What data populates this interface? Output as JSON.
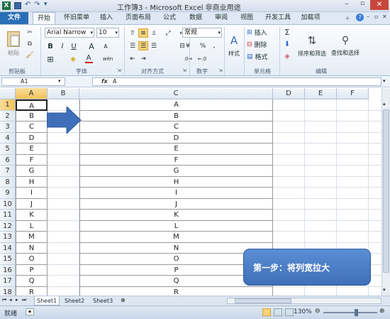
{
  "window": {
    "title": "工作簿3 - Microsoft Excel 非商业用途"
  },
  "tabs": [
    "文件",
    "开始",
    "怀旧菜单",
    "插入",
    "页面布局",
    "公式",
    "数据",
    "审阅",
    "视图",
    "开发工具",
    "加载项"
  ],
  "ribbon": {
    "paste": "粘贴",
    "clipboard_label": "剪贴板",
    "font_name": "Arial Narrow",
    "font_size": "10",
    "bold": "B",
    "italic": "I",
    "underline": "U",
    "font_grow": "A",
    "font_shrink": "A",
    "font_color_glyph": "A",
    "wen": "wén",
    "font_label": "字体",
    "align_label": "对齐方式",
    "number_format": "常规",
    "percent": "%",
    "comma": ",",
    "number_label": "数字",
    "style": "样式",
    "insert": "插入",
    "delete": "删除",
    "format": "格式",
    "cells_label": "单元格",
    "sort_filter": "排序和筛选",
    "find_select": "查找和选择",
    "edit_label": "编辑"
  },
  "formula_bar": {
    "name_box": "A1",
    "fx": "fx",
    "content": "A"
  },
  "columns": [
    "A",
    "B",
    "C",
    "D",
    "E",
    "F"
  ],
  "rows": [
    "1",
    "2",
    "3",
    "4",
    "5",
    "6",
    "7",
    "8",
    "9",
    "10",
    "11",
    "12",
    "13",
    "14",
    "15",
    "16",
    "17",
    "18"
  ],
  "col_a_values": [
    "A",
    "B",
    "C",
    "D",
    "E",
    "F",
    "G",
    "H",
    "I",
    "J",
    "K",
    "L",
    "M",
    "N",
    "O",
    "P",
    "Q",
    "R"
  ],
  "col_c_values": [
    "A",
    "B",
    "C",
    "D",
    "E",
    "F",
    "G",
    "H",
    "I",
    "J",
    "K",
    "L",
    "M",
    "N",
    "O",
    "P",
    "Q",
    "R"
  ],
  "sheets": [
    "Sheet1",
    "Sheet2",
    "Sheet3"
  ],
  "status": {
    "ready": "就绪",
    "zoom": "130%"
  },
  "callout": {
    "text": "第一步：将列宽拉大"
  },
  "colors": {
    "file_tab": "#2a6fb6",
    "selection": "#f2c35a",
    "arrow": "#3f6fb8"
  }
}
